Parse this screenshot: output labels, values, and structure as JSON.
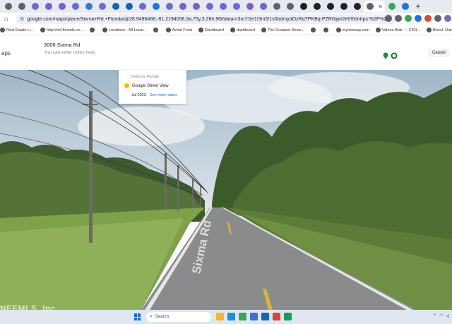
{
  "browser": {
    "tabs": [
      {
        "icon": "generic-icon",
        "color": "#5f6368"
      },
      {
        "icon": "search-icon",
        "color": "#5f6368"
      },
      {
        "icon": "web-icon",
        "color": "#6b6bd6"
      },
      {
        "icon": "web-icon",
        "color": "#7a5cd6"
      },
      {
        "icon": "web-icon",
        "color": "#7a5cd6"
      },
      {
        "icon": "web-icon",
        "color": "#6b6bd6"
      },
      {
        "icon": "web-icon",
        "color": "#2f7bd6"
      },
      {
        "icon": "web-icon",
        "color": "#6b6bd6"
      },
      {
        "icon": "linkedin-icon",
        "color": "#0a66c2"
      },
      {
        "icon": "linkedin-icon",
        "color": "#0a66c2"
      },
      {
        "icon": "web-icon",
        "color": "#6b6bd6"
      },
      {
        "icon": "facebook-icon",
        "color": "#1877f2"
      },
      {
        "icon": "web-icon",
        "color": "#6b6bd6"
      },
      {
        "icon": "web-icon",
        "color": "#7a5cd6"
      },
      {
        "icon": "web-icon",
        "color": "#7a5cd6"
      },
      {
        "icon": "web-icon",
        "color": "#6b6bd6"
      },
      {
        "icon": "web-icon",
        "color": "#6b6bd6"
      },
      {
        "icon": "web-icon",
        "color": "#6b6bd6"
      },
      {
        "icon": "web-icon",
        "color": "#7a5cd6"
      },
      {
        "icon": "web-icon",
        "color": "#6b6bd6"
      },
      {
        "icon": "web-icon",
        "color": "#5f6368"
      },
      {
        "icon": "web-icon",
        "color": "#5f6368"
      },
      {
        "icon": "web-icon",
        "color": "#202124"
      },
      {
        "icon": "web-icon",
        "color": "#202124"
      },
      {
        "icon": "web-icon",
        "color": "#202124"
      },
      {
        "icon": "web-icon",
        "color": "#202124"
      },
      {
        "icon": "web-icon",
        "color": "#202124"
      }
    ],
    "active_tab_close": "×",
    "trailing_tabs": [
      {
        "icon": "chrome-icon",
        "color": "#34a853"
      },
      {
        "icon": "chrome-icon",
        "color": "#1a73e8"
      }
    ],
    "new_tab": "+",
    "url": "google.com/maps/place/Sixma+Rd,+Florida/@28.9496468,-81.2194056,3a,75y,3.26h,90t/data=!3m7!1e1!3m5!1s0bdmydOzRqTPKBq-PZR0qw!2e0!6shttps:%2F%2Fstreetviewpixels-pa.googl...",
    "bookmarks": [
      {
        "label": "Real Estate Li..."
      },
      {
        "label": "http://nef.flexmls.co..."
      },
      {
        "label": ""
      },
      {
        "label": "Locations - All Locat..."
      },
      {
        "label": ""
      },
      {
        "label": "Aerial Front"
      },
      {
        "label": "Dashboard"
      },
      {
        "label": "dashboard"
      },
      {
        "label": "The Greatest Show..."
      },
      {
        "label": ""
      },
      {
        "label": ""
      },
      {
        "label": "mynewsap.com"
      },
      {
        "label": "Valerie Blair — CEN..."
      },
      {
        "label": "Blood, Urine & Oth..."
      }
    ]
  },
  "maps": {
    "logo_fragment": "aps",
    "place_title": "3006 Sixma Rd",
    "notes_placeholder": "You can enter notes here.",
    "cancel_label": "Cancel",
    "info_card": {
      "location": "Deltona, Florida",
      "provider": "Google Street View",
      "date": "Jul 2023",
      "more_dates": "See more dates"
    },
    "road_text": "Sixma Rd",
    "watermark": "NEFMLS, Inc"
  },
  "taskbar": {
    "search_label": "Search",
    "apps": [
      {
        "icon": "file-explorer-icon",
        "color": "#f2b632"
      },
      {
        "icon": "edge-icon",
        "color": "#1f8ed6"
      },
      {
        "icon": "chrome-icon",
        "color": "#34a853"
      },
      {
        "icon": "store-icon",
        "color": "#3a6fd8"
      },
      {
        "icon": "mail-icon",
        "color": "#1565c0"
      },
      {
        "icon": "chrome-icon",
        "color": "#db4437"
      },
      {
        "icon": "app-icon",
        "color": "#0f9d58"
      }
    ]
  }
}
